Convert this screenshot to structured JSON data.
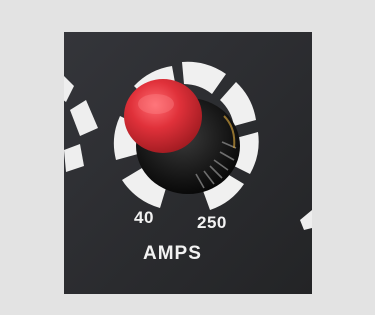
{
  "dial": {
    "min_label": "40",
    "max_label": "250",
    "unit_label": "AMPS"
  },
  "colors": {
    "background": "#e3e3e3",
    "panel": "#2b2c2e",
    "knob_cap": "#e0313a",
    "scale_segments": "#f0f0f0"
  }
}
